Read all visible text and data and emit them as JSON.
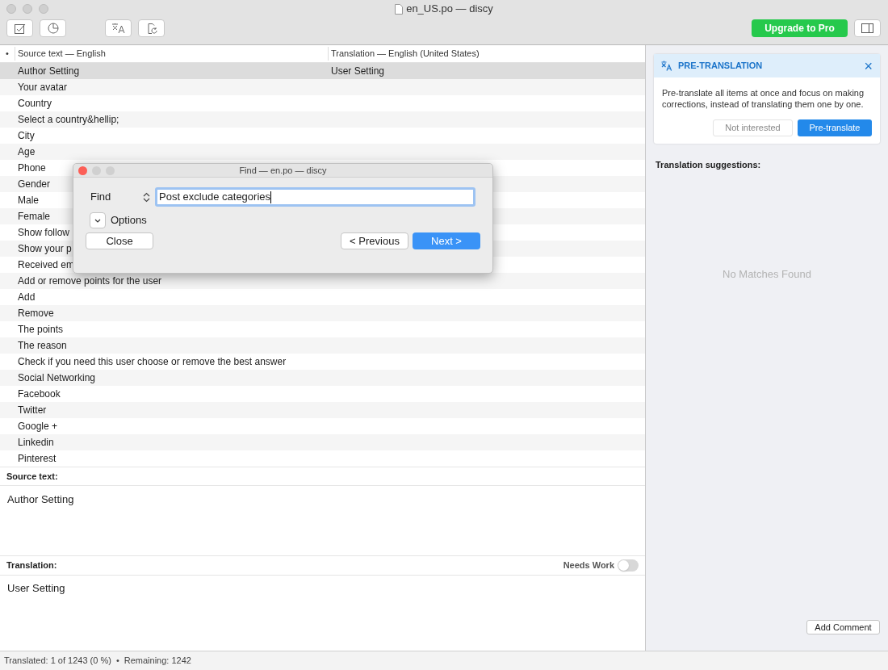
{
  "window": {
    "title": "en_US.po — discy"
  },
  "toolbar": {
    "upgrade_button": "Upgrade to Pro"
  },
  "table": {
    "columns": [
      "•",
      "Source text — English",
      "Translation — English (United States)"
    ],
    "rows": [
      {
        "source": "Author Setting",
        "translation": "User Setting",
        "selected": true
      },
      {
        "source": "Your avatar",
        "selected": false
      },
      {
        "source": "Country",
        "selected": false
      },
      {
        "source": "Select a country&hellip;",
        "selected": false
      },
      {
        "source": "City",
        "selected": false
      },
      {
        "source": "Age",
        "selected": false
      },
      {
        "source": "Phone",
        "selected": false
      },
      {
        "source": "Gender",
        "selected": false
      },
      {
        "source": "Male",
        "selected": false
      },
      {
        "source": "Female",
        "selected": false
      },
      {
        "source": "Show follow",
        "selected": false
      },
      {
        "source": "Show your p",
        "selected": false
      },
      {
        "source": "Received em",
        "selected": false
      },
      {
        "source": "Add or remove points for the user",
        "selected": false
      },
      {
        "source": "Add",
        "selected": false
      },
      {
        "source": "Remove",
        "selected": false
      },
      {
        "source": "The points",
        "selected": false
      },
      {
        "source": "The reason",
        "selected": false
      },
      {
        "source": "Check if you need this user choose or remove the best answer",
        "selected": false
      },
      {
        "source": "Social Networking",
        "selected": false
      },
      {
        "source": "Facebook",
        "selected": false
      },
      {
        "source": "Twitter",
        "selected": false
      },
      {
        "source": "Google +",
        "selected": false
      },
      {
        "source": "Linkedin",
        "selected": false
      },
      {
        "source": "Pinterest",
        "selected": false
      }
    ]
  },
  "find_dialog": {
    "title": "Find — en.po — discy",
    "label": "Find",
    "value": "Post exclude categories",
    "options": "Options",
    "buttons": [
      "Close",
      "< Previous",
      "Next >"
    ]
  },
  "source_panel": {
    "heading": "Source text:",
    "text": "Author Setting"
  },
  "translation_panel": {
    "heading": "Translation:",
    "needs_work": {
      "label": "Needs Work",
      "on": false
    },
    "text": "User Setting"
  },
  "status_bar": {
    "translated": "Translated: 1 of 1243 (0 %)",
    "separator": "•",
    "remaining": "Remaining: 1242"
  },
  "pretranslation": {
    "title": "PRE-TRANSLATION",
    "close": "×",
    "text": "Pre-translate all items at once and focus on making corrections, instead of translating them one by one.",
    "buttons": [
      "Not interested",
      "Pre-translate"
    ]
  },
  "suggestions": {
    "heading": "Translation suggestions:",
    "empty": "No Matches Found",
    "add_comment": "Add Comment"
  }
}
